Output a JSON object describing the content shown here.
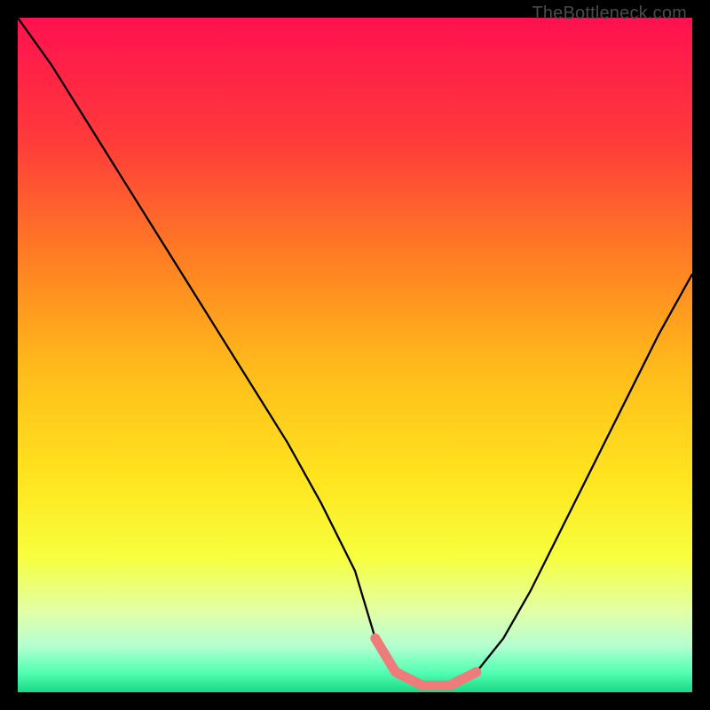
{
  "watermark": "TheBottleneck.com",
  "chart_data": {
    "type": "line",
    "title": "",
    "xlabel": "",
    "ylabel": "",
    "xlim": [
      0,
      100
    ],
    "ylim": [
      0,
      100
    ],
    "grid": false,
    "series": [
      {
        "name": "bottleneck-curve",
        "x": [
          0,
          5,
          10,
          15,
          20,
          25,
          30,
          35,
          40,
          45,
          50,
          53,
          56,
          60,
          64,
          68,
          72,
          76,
          80,
          85,
          90,
          95,
          100
        ],
        "y": [
          100,
          93,
          85,
          77,
          69,
          61,
          53,
          45,
          37,
          28,
          18,
          8,
          3,
          1,
          1,
          3,
          8,
          15,
          23,
          33,
          43,
          53,
          62
        ]
      },
      {
        "name": "bottom-highlight",
        "x": [
          53,
          56,
          60,
          64,
          68
        ],
        "y": [
          8,
          3,
          1,
          1,
          3
        ]
      }
    ],
    "background_gradient": {
      "stops": [
        {
          "pos": 0.0,
          "color": "#ff114f"
        },
        {
          "pos": 0.18,
          "color": "#ff3a3b"
        },
        {
          "pos": 0.35,
          "color": "#ff7c23"
        },
        {
          "pos": 0.52,
          "color": "#ffbb1b"
        },
        {
          "pos": 0.68,
          "color": "#ffe41e"
        },
        {
          "pos": 0.8,
          "color": "#f7ff3e"
        },
        {
          "pos": 0.88,
          "color": "#e2ffa7"
        },
        {
          "pos": 0.93,
          "color": "#b6ffd1"
        },
        {
          "pos": 0.97,
          "color": "#54ffb4"
        },
        {
          "pos": 1.0,
          "color": "#18d986"
        }
      ]
    }
  }
}
